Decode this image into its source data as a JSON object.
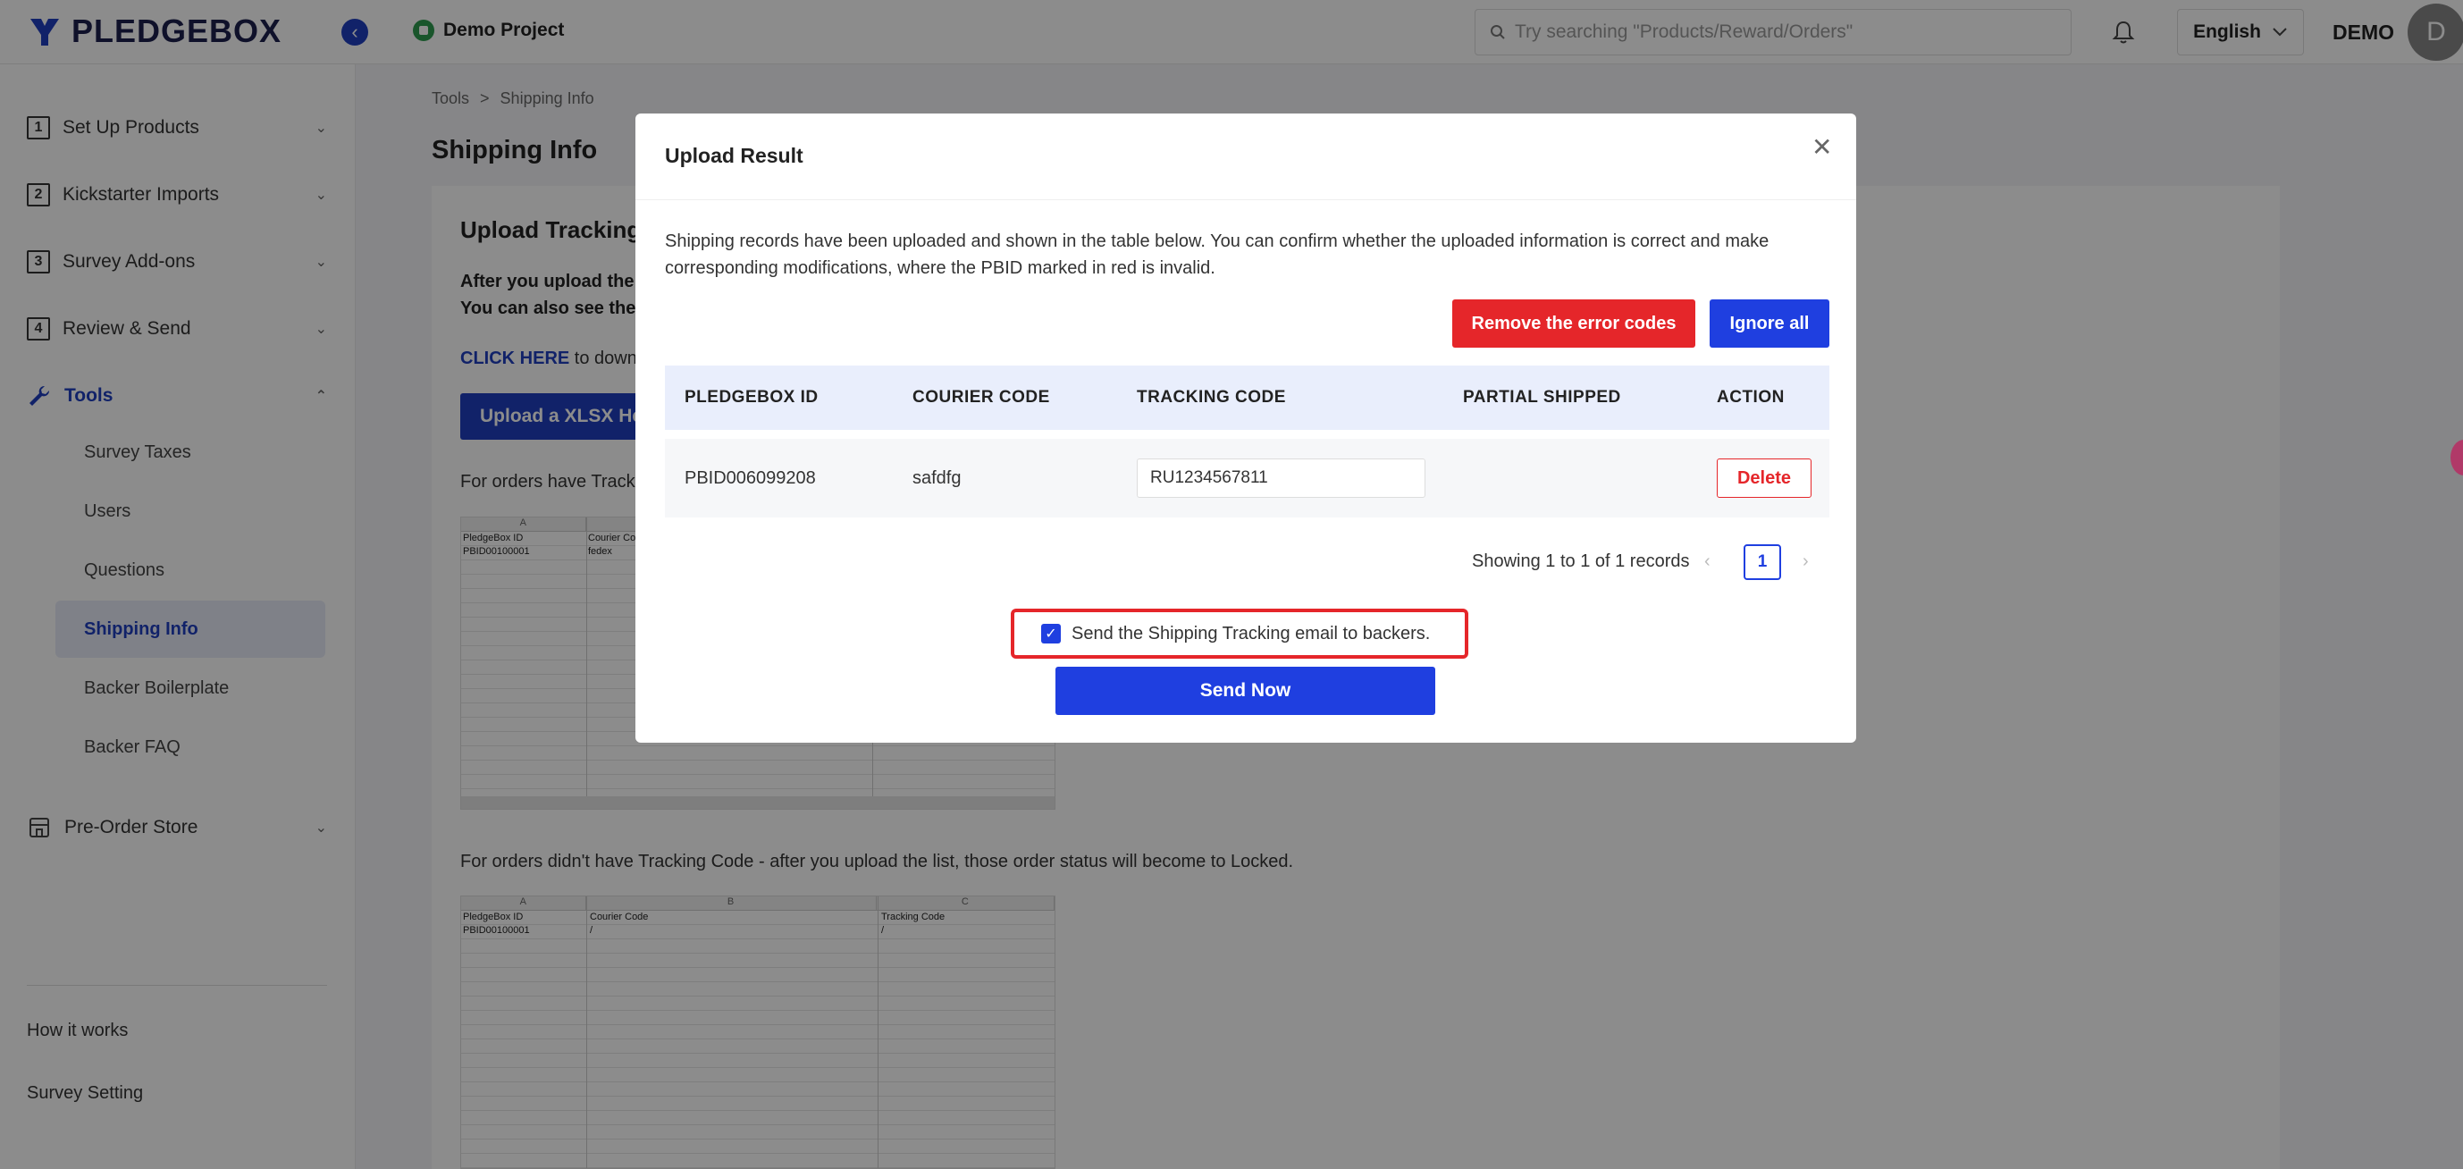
{
  "header": {
    "logo_text": "PLEDGEBOX",
    "project_name": "Demo Project",
    "search_placeholder": "Try searching \"Products/Reward/Orders\"",
    "language": "English",
    "user_name": "DEMO",
    "avatar_letter": "D",
    "brand_color": "#1f3fbf"
  },
  "sidebar": {
    "items": [
      {
        "num": "1",
        "label": "Set Up Products"
      },
      {
        "num": "2",
        "label": "Kickstarter Imports"
      },
      {
        "num": "3",
        "label": "Survey Add-ons"
      },
      {
        "num": "4",
        "label": "Review & Send"
      }
    ],
    "tools_label": "Tools",
    "tools_sub": [
      "Survey Taxes",
      "Users",
      "Questions",
      "Shipping Info",
      "Backer Boilerplate",
      "Backer FAQ"
    ],
    "pre_order_label": "Pre-Order Store",
    "footer": [
      "How it works",
      "Survey Setting"
    ]
  },
  "main": {
    "breadcrumb": [
      "Tools",
      ">",
      "Shipping Info"
    ],
    "page_title": "Shipping Info",
    "card_title": "Upload Tracking",
    "desc_line1": "After you upload the",
    "desc_line2": "You can also see the",
    "click_here": "CLICK HERE",
    "click_here_rest": " to down",
    "upload_button": "Upload a XLSX Her",
    "note1": "For orders have Track",
    "note2": "For orders didn't have Tracking Code - after you upload the list, those order status will become to Locked.",
    "sheet1": {
      "col_a": "A",
      "r1c1": "PledgeBox ID",
      "r1c2": "Courier Co",
      "r2c1": "PBID00100001",
      "r2c2": "fedex"
    },
    "sheet2": {
      "col_a": "A",
      "col_b": "B",
      "col_c": "C",
      "r1c1": "PledgeBox ID",
      "r1c2": "Courier Code",
      "r1c3": "Tracking Code",
      "r2c1": "PBID00100001",
      "r2c2": "/",
      "r2c3": "/"
    }
  },
  "modal": {
    "title": "Upload Result",
    "description": "Shipping records have been uploaded and shown in the table below. You can confirm whether the uploaded information is correct and make corresponding modifications, where the PBID marked in red is invalid.",
    "remove_button": "Remove the error codes",
    "ignore_button": "Ignore all",
    "columns": [
      "PLEDGEBOX ID",
      "COURIER CODE",
      "TRACKING CODE",
      "PARTIAL SHIPPED",
      "ACTION"
    ],
    "rows": [
      {
        "pledgebox_id": "PBID006099208",
        "courier_code": "safdfg",
        "tracking_code": "RU1234567811",
        "partial_shipped": "",
        "action": "Delete"
      }
    ],
    "pager_text": "Showing 1 to 1 of 1 records",
    "current_page": "1",
    "checkbox_label": "Send the Shipping Tracking email to backers.",
    "checkbox_checked": true,
    "send_button": "Send Now",
    "accent_red": "#e5262a",
    "accent_blue": "#1f3fe0"
  }
}
